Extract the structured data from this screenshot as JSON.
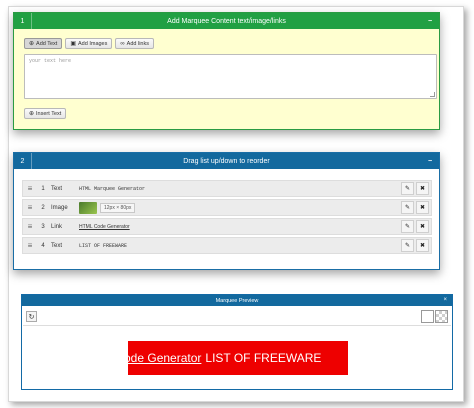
{
  "panel1": {
    "number": "1",
    "title": "Add Marquee Content text/image/links",
    "collapse_icon": "minus",
    "buttons": [
      {
        "label": "Add Text",
        "icon": "plus-circle-icon",
        "active": true
      },
      {
        "label": "Add Images",
        "icon": "image-icon",
        "active": false
      },
      {
        "label": "Add links",
        "icon": "link-icon",
        "active": false
      }
    ],
    "textarea_placeholder": "your text here",
    "insert_label": "Insert Text",
    "colors": {
      "header": "#21a043",
      "body": "#ffffd0"
    }
  },
  "panel2": {
    "number": "2",
    "title": "Drag list up/down to reorder",
    "collapse_icon": "minus",
    "rows": [
      {
        "num": "1",
        "type": "Text",
        "content": "HTML Marquee Generator"
      },
      {
        "num": "2",
        "type": "Image",
        "content": "",
        "size": "12px × 80px"
      },
      {
        "num": "3",
        "type": "Link",
        "content": "HTML Code Generator"
      },
      {
        "num": "4",
        "type": "Text",
        "content": "LIST OF FREEWARE"
      }
    ],
    "colors": {
      "header": "#13699e"
    }
  },
  "panel3": {
    "title": "Marquee Preview",
    "close_icon": "×",
    "marquee_link": "ode Generator",
    "marquee_text": "LIST OF FREEWARE",
    "colors": {
      "marquee_bg": "#ee0000"
    }
  }
}
